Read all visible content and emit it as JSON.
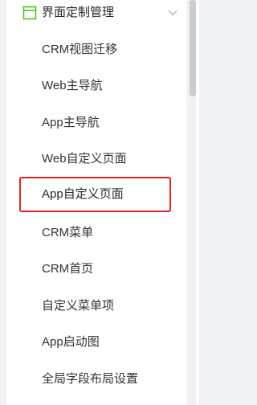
{
  "menu": {
    "group_title": "界面定制管理",
    "group_icon": "window-layout-icon",
    "expand_icon": "chevron-down-icon",
    "accent_color": "#52c41a",
    "highlight_color": "#e02424",
    "items": [
      {
        "label": "CRM视图迁移"
      },
      {
        "label": "Web主导航"
      },
      {
        "label": "App主导航"
      },
      {
        "label": "Web自定义页面"
      },
      {
        "label": "App自定义页面"
      },
      {
        "label": "CRM菜单"
      },
      {
        "label": "CRM首页"
      },
      {
        "label": "自定义菜单项"
      },
      {
        "label": "App启动图"
      },
      {
        "label": "全局字段布局设置"
      }
    ]
  }
}
